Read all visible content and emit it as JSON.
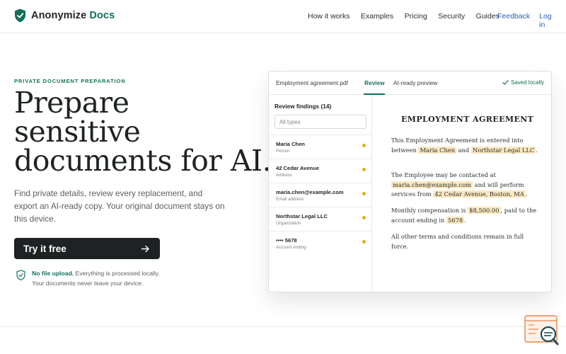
{
  "brand": {
    "name": "Anonymize",
    "accent": "Docs",
    "color": "#13705a"
  },
  "nav": {
    "links": [
      "How it works",
      "Examples",
      "Pricing",
      "Security",
      "Guides"
    ],
    "feedback": "Feedback",
    "login": "Log in"
  },
  "hero": {
    "eyebrow": "PRIVATE DOCUMENT PREPARATION",
    "headline_line1": "Prepare",
    "headline_line2": "sensitive",
    "headline_line3": "documents for AI.",
    "subtext": "Find private details, review every replacement, and export an AI-ready copy. Your original document stays on this device.",
    "cta": "Try it free",
    "notice_strong": "No file upload.",
    "notice_text": "Everything is processed locally.",
    "notice_line2": "Your documents never leave your device."
  },
  "app": {
    "tabs": {
      "file": "Employment agreement.pdf",
      "review": "Review",
      "preview": "AI-ready preview"
    },
    "saved": "Saved locally",
    "findings_title": "Review findings (14)",
    "filter_placeholder": "All types",
    "findings": [
      {
        "name": "Maria Chen",
        "type": "Person"
      },
      {
        "name": "42 Cedar Avenue",
        "type": "Address"
      },
      {
        "name": "maria.chen@example.com",
        "type": "Email address"
      },
      {
        "name": "Northstar Legal LLC",
        "type": "Organization"
      },
      {
        "name": "•••• 5678",
        "type": "Account ending"
      }
    ],
    "doc": {
      "title": "EMPLOYMENT AGREEMENT",
      "p1_a": "This Employment Agreement is entered into between",
      "p1_h1": "Maria Chen",
      "p1_b": "and",
      "p1_h2": "Northstar Legal LLC",
      "p1_c": ".",
      "p2_a": "The Employee may be contacted at",
      "p2_h1": "maria.chen@example.com",
      "p2_b": "and will perform services from",
      "p2_h2": "42 Cedar Avenue, Boston, MA",
      "p2_c": ".",
      "p3_a": "Monthly compensation is",
      "p3_h1": "$8,500.00",
      "p3_b": ", paid to the account ending in",
      "p3_h2": "5678",
      "p3_c": ".",
      "p4": "All other terms and conditions remain in full force."
    }
  }
}
